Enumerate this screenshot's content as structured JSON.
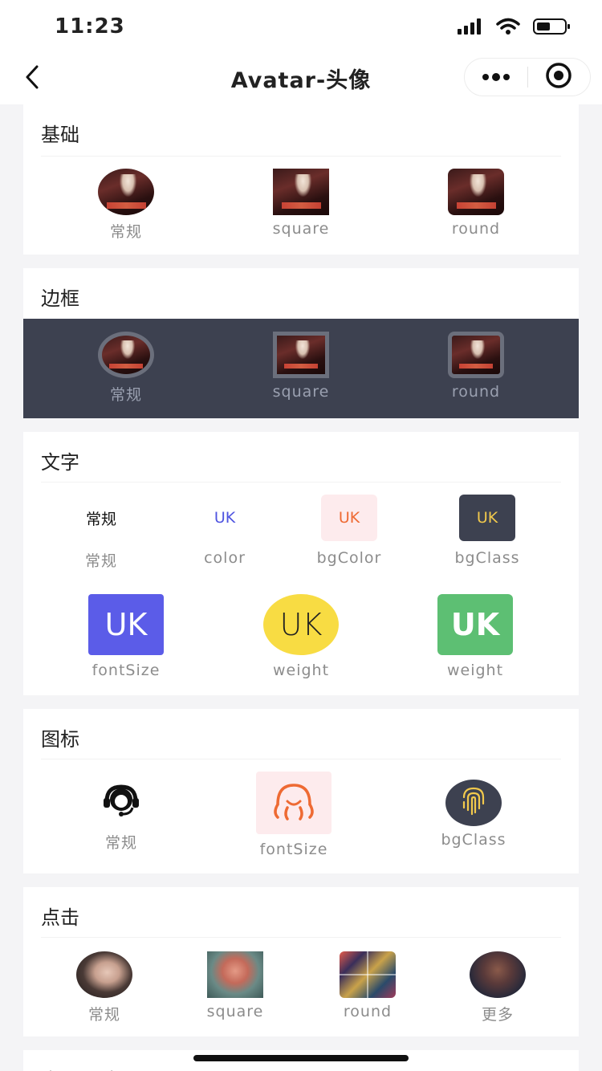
{
  "status": {
    "time": "11:23"
  },
  "nav": {
    "title": "Avatar-头像"
  },
  "icons": {
    "signal": "cellular-signal-icon",
    "wifi": "wifi-icon",
    "battery": "battery-icon",
    "back": "chevron-left-icon",
    "more": "more-dots-icon",
    "close": "target-circle-icon"
  },
  "colors": {
    "dark_bg": "#3d4150",
    "text_color": "#4f54e0",
    "bg_pink": "#fdebed",
    "bg_orange_text": "#ee6a33",
    "bg_dark_text": "#f2c94c",
    "fontsize_bg": "#5b5ce8",
    "weight_yellow": "#f8dc43",
    "weight_green": "#5dbf73"
  },
  "sections": {
    "basic": {
      "title": "基础",
      "items": [
        {
          "label": "常规"
        },
        {
          "label": "square"
        },
        {
          "label": "round"
        }
      ]
    },
    "border": {
      "title": "边框",
      "items": [
        {
          "label": "常规"
        },
        {
          "label": "square"
        },
        {
          "label": "round"
        }
      ]
    },
    "text": {
      "title": "文字",
      "row1": [
        {
          "text": "常规",
          "label": "常规"
        },
        {
          "text": "UK",
          "label": "color"
        },
        {
          "text": "UK",
          "label": "bgColor"
        },
        {
          "text": "UK",
          "label": "bgClass"
        }
      ],
      "row2": [
        {
          "text": "UK",
          "label": "fontSize"
        },
        {
          "text": "UK",
          "label": "weight"
        },
        {
          "text": "UK",
          "label": "weight"
        }
      ]
    },
    "icon": {
      "title": "图标",
      "items": [
        {
          "icon": "headset-user-icon",
          "label": "常规"
        },
        {
          "icon": "octopus-icon",
          "label": "fontSize"
        },
        {
          "icon": "fingerprint-icon",
          "label": "bgClass"
        }
      ]
    },
    "click": {
      "title": "点击",
      "items": [
        {
          "label": "常规"
        },
        {
          "label": "square"
        },
        {
          "label": "round"
        },
        {
          "label": "更多"
        }
      ]
    },
    "next": {
      "title": "内置尺寸"
    }
  }
}
